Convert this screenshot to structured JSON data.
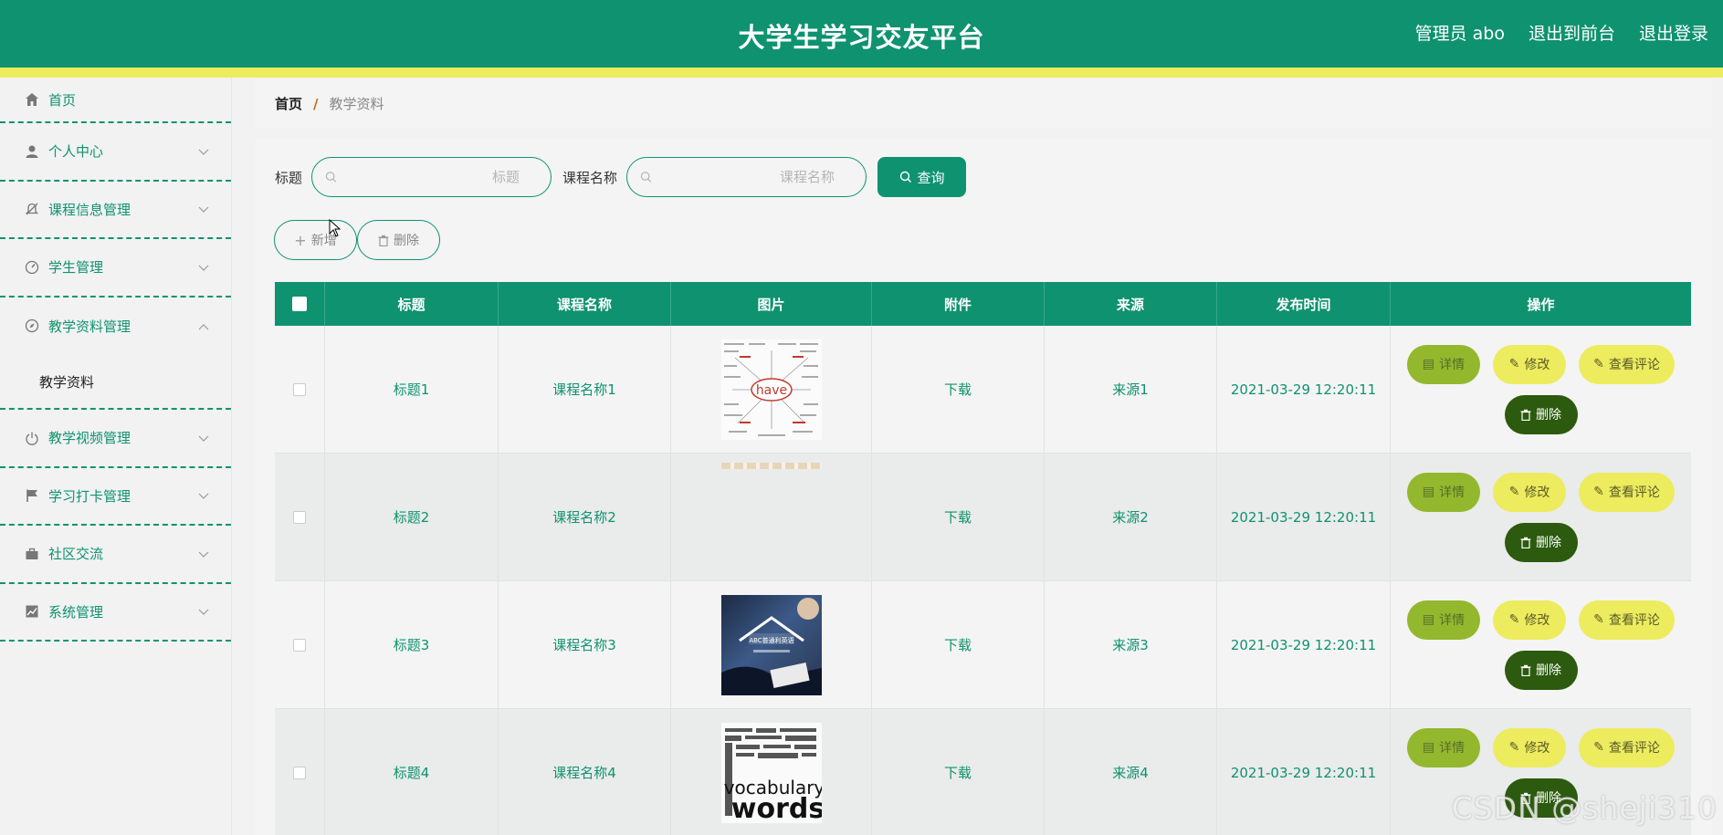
{
  "header": {
    "app_title": "大学生学习交友平台",
    "links": [
      "管理员 abo",
      "退出到前台",
      "退出登录"
    ]
  },
  "sidebar": {
    "items": [
      {
        "label": "首页",
        "icon": "home-icon"
      },
      {
        "label": "个人中心",
        "icon": "user-icon"
      },
      {
        "label": "课程信息管理",
        "icon": "bell-off-icon"
      },
      {
        "label": "学生管理",
        "icon": "gauge-icon"
      },
      {
        "label": "教学资料管理",
        "icon": "compass-icon",
        "expanded": true,
        "children": [
          "教学资料"
        ]
      },
      {
        "label": "教学视频管理",
        "icon": "power-icon"
      },
      {
        "label": "学习打卡管理",
        "icon": "flag-icon"
      },
      {
        "label": "社区交流",
        "icon": "briefcase-icon"
      },
      {
        "label": "系统管理",
        "icon": "chart-icon"
      }
    ]
  },
  "breadcrumb": {
    "home": "首页",
    "separator": "/",
    "current": "教学资料"
  },
  "search": {
    "title_label": "标题",
    "title_placeholder": "标题",
    "course_label": "课程名称",
    "course_placeholder": "课程名称",
    "query_button": "查询"
  },
  "actions": {
    "add": "新增",
    "delete": "删除"
  },
  "table": {
    "headers": [
      "标题",
      "课程名称",
      "图片",
      "附件",
      "来源",
      "发布时间",
      "操作"
    ],
    "rows": [
      {
        "title": "标题1",
        "course": "课程名称1",
        "image": "word-map-have",
        "attachment": "下载",
        "source": "来源1",
        "time": "2021-03-29 12:20:11"
      },
      {
        "title": "标题2",
        "course": "课程名称2",
        "image": "blank-strip",
        "attachment": "下载",
        "source": "来源2",
        "time": "2021-03-29 12:20:11"
      },
      {
        "title": "标题3",
        "course": "课程名称3",
        "image": "book-photo",
        "attachment": "下载",
        "source": "来源3",
        "time": "2021-03-29 12:20:11"
      },
      {
        "title": "标题4",
        "course": "课程名称4",
        "image": "vocabulary-words",
        "attachment": "下载",
        "source": "来源4",
        "time": "2021-03-29 12:20:11"
      }
    ],
    "row_actions": {
      "detail": "详情",
      "edit": "修改",
      "comments": "查看评论",
      "delete": "删除"
    }
  },
  "thumbnails": {
    "have_word": "have",
    "vocab_word": "vocabulary",
    "words_word": "words",
    "book_text": "ABC普通利英语"
  },
  "watermark": "CSDN @sheji310",
  "colors": {
    "primary": "#0f9270",
    "accent_yellow": "#ecec5e",
    "detail_green": "#93b82e",
    "delete_dark": "#2c5a0e"
  }
}
